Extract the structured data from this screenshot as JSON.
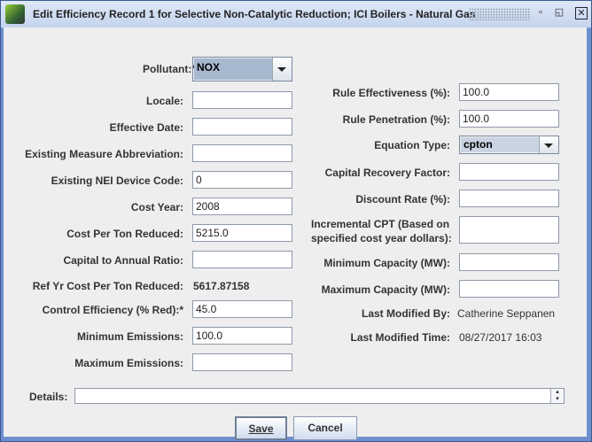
{
  "window": {
    "title": "Edit Efficiency Record 1 for Selective Non-Catalytic Reduction; ICI Boilers - Natural Gas"
  },
  "left": {
    "pollutant": {
      "label": "Pollutant:*",
      "value": "NOX"
    },
    "locale": {
      "label": "Locale:",
      "value": ""
    },
    "effective_date": {
      "label": "Effective Date:",
      "value": ""
    },
    "measure_abbrev": {
      "label": "Existing Measure Abbreviation:",
      "value": ""
    },
    "nei_code": {
      "label": "Existing NEI Device Code:",
      "value": "0"
    },
    "cost_year": {
      "label": "Cost Year:",
      "value": "2008"
    },
    "cost_per_ton": {
      "label": "Cost Per Ton Reduced:",
      "value": "5215.0"
    },
    "cap_annual": {
      "label": "Capital to Annual Ratio:",
      "value": ""
    },
    "ref_yr": {
      "label": "Ref Yr Cost Per Ton Reduced:",
      "value": "5617.87158"
    },
    "control_eff": {
      "label": "Control Efficiency (% Red):*",
      "value": "45.0"
    },
    "min_emis": {
      "label": "Minimum Emissions:",
      "value": "100.0"
    },
    "max_emis": {
      "label": "Maximum Emissions:",
      "value": ""
    }
  },
  "right": {
    "rule_eff": {
      "label": "Rule Effectiveness (%):",
      "value": "100.0"
    },
    "rule_pen": {
      "label": "Rule Penetration (%):",
      "value": "100.0"
    },
    "eq_type": {
      "label": "Equation Type:",
      "value": "cpton"
    },
    "crf": {
      "label": "Capital Recovery Factor:",
      "value": ""
    },
    "discount": {
      "label": "Discount Rate (%):",
      "value": ""
    },
    "incr_cpt": {
      "label1": "Incremental CPT (Based on",
      "label2": "specified cost year dollars):",
      "value": ""
    },
    "min_cap": {
      "label": "Minimum Capacity (MW):",
      "value": ""
    },
    "max_cap": {
      "label": "Maximum Capacity (MW):",
      "value": ""
    },
    "mod_by": {
      "label": "Last Modified By:",
      "value": "Catherine Seppanen"
    },
    "mod_time": {
      "label": "Last Modified Time:",
      "value": "08/27/2017 16:03"
    }
  },
  "details": {
    "label": "Details:",
    "value": ""
  },
  "buttons": {
    "save": "Save",
    "cancel": "Cancel"
  }
}
